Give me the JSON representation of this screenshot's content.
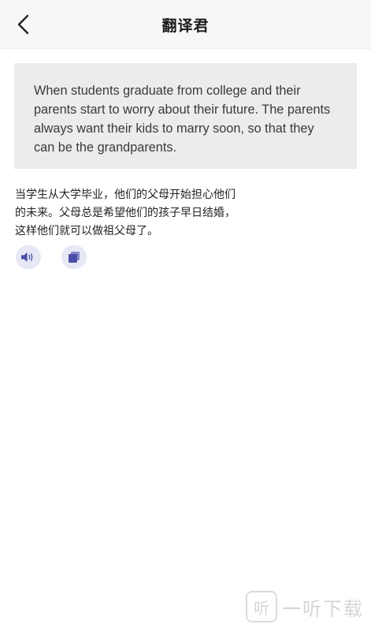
{
  "header": {
    "title": "翻译君",
    "back_icon": "chevron-left-icon"
  },
  "source": {
    "text": "When students graduate from college and their parents start to worry about their future. The parents always want their kids to marry soon, so that they can be the grandparents."
  },
  "result": {
    "lines": [
      "当学生从大学毕业，他们的父母开始担心他们",
      "的未来。父母总是希望他们的孩子早日结婚，",
      "这样他们就可以做祖父母了。"
    ]
  },
  "actions": {
    "speaker_icon": "speaker-icon",
    "copy_icon": "copy-icon",
    "accent": "#4a4ea8",
    "bubble": "#e7e8f6"
  },
  "watermark": {
    "logo": "听",
    "text": "一听下载"
  }
}
